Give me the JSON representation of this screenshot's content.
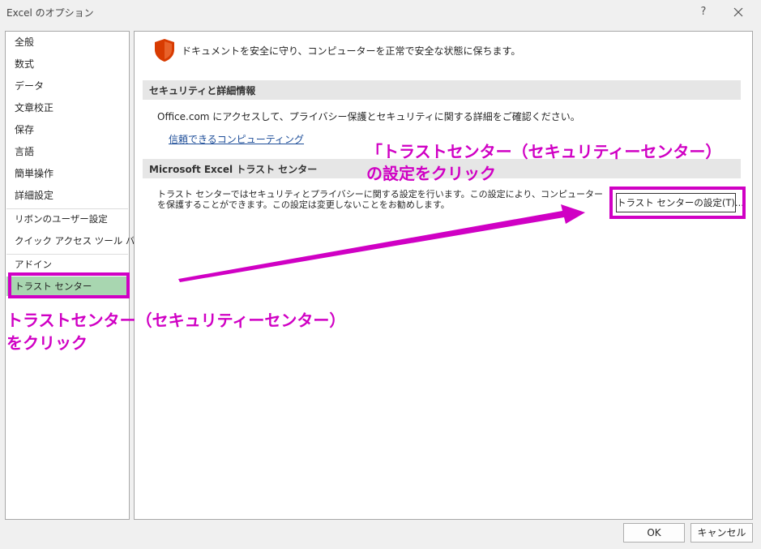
{
  "window": {
    "title": "Excel のオプション",
    "help_label": "?",
    "close_icon": "close-icon"
  },
  "sidebar": {
    "items": [
      {
        "label": "全般"
      },
      {
        "label": "数式"
      },
      {
        "label": "データ"
      },
      {
        "label": "文章校正"
      },
      {
        "label": "保存"
      },
      {
        "label": "言語"
      },
      {
        "label": "簡単操作"
      },
      {
        "label": "詳細設定"
      },
      {
        "label": "リボンのユーザー設定"
      },
      {
        "label": "クイック アクセス ツール バー"
      },
      {
        "label": "アドイン"
      },
      {
        "label": "トラスト センター",
        "selected": true
      }
    ]
  },
  "main": {
    "intro": "ドキュメントを安全に守り、コンピューターを正常で安全な状態に保ちます。",
    "section1": {
      "header": "セキュリティと詳細情報",
      "text": "Office.com にアクセスして、プライバシー保護とセキュリティに関する詳細をご確認ください。",
      "link": "信頼できるコンピューティング"
    },
    "section2": {
      "header": "Microsoft Excel トラスト センター",
      "text": "トラスト センターではセキュリティとプライバシーに関する設定を行います。この設定により、コンピューターを保護することができます。この設定は変更しないことをお勧めします。",
      "button": "トラスト センターの設定(T)..."
    }
  },
  "footer": {
    "ok": "OK",
    "cancel": "キャンセル"
  },
  "annotations": {
    "top_line1": "「トラストセンター（セキュリティーセンター）",
    "top_line2": "の設定をクリック",
    "left_line1": "トラストセンター（セキュリティーセンター）",
    "left_line2": "をクリック",
    "color": "#d000c4"
  },
  "colors": {
    "selected_bg": "#a8d6b0",
    "shield": "#d83b01",
    "link": "#1e4e99"
  }
}
